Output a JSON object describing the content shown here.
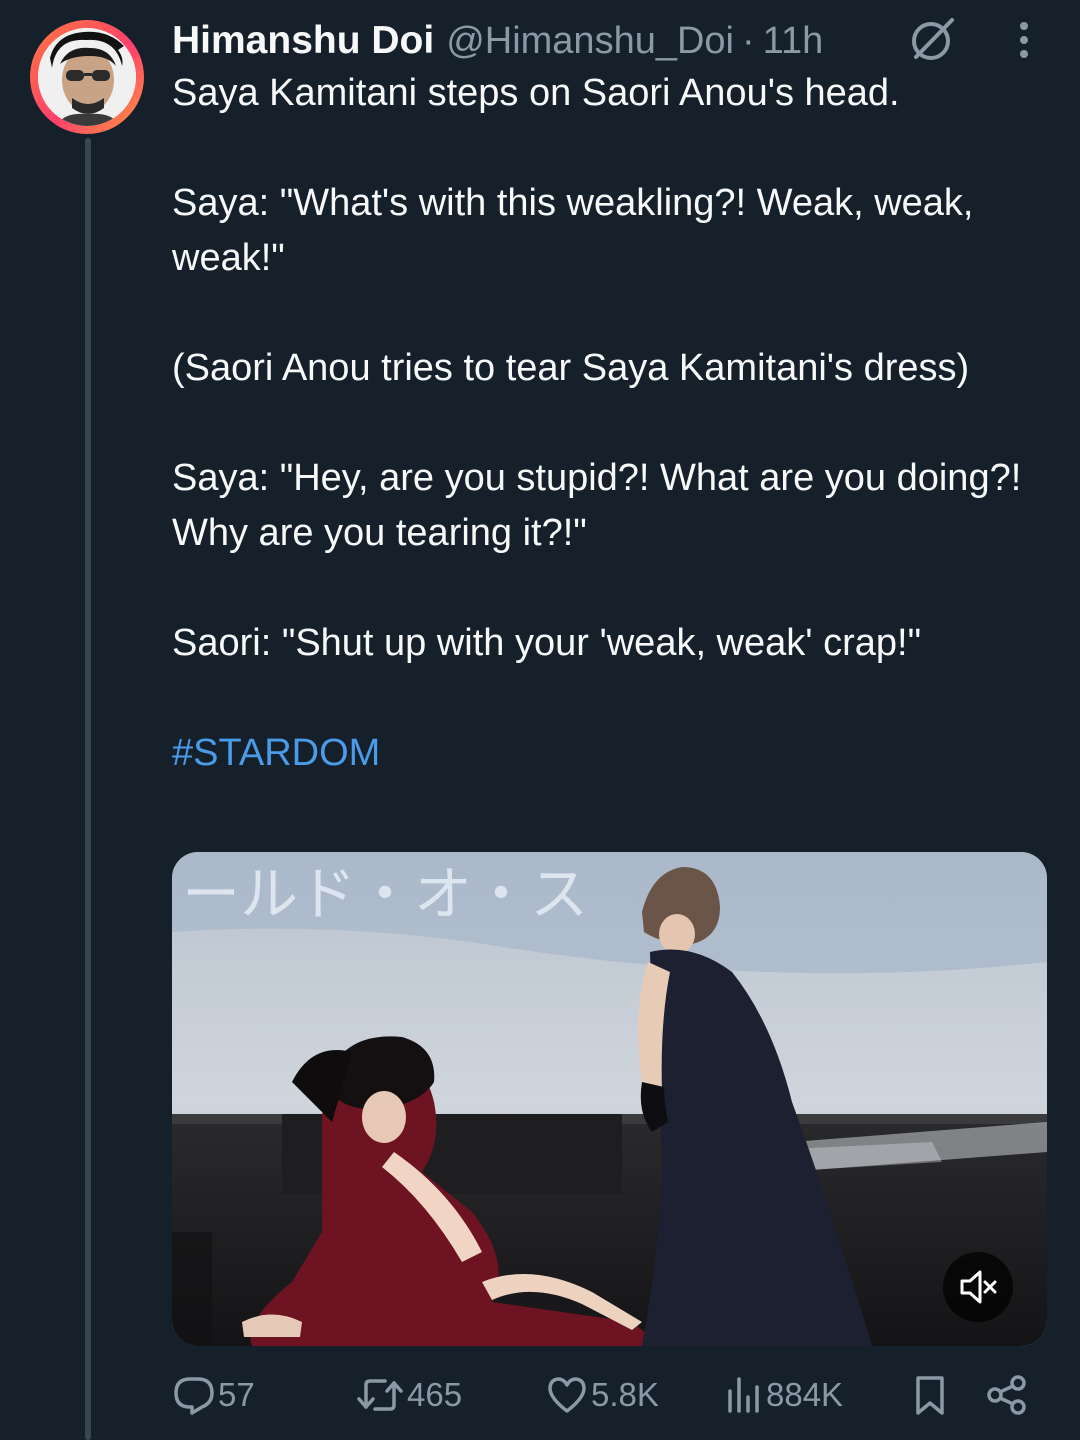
{
  "tweet": {
    "author": {
      "display_name": "Himanshu Doi",
      "handle": "@Himanshu_Doi",
      "separator": "·",
      "time": "11h"
    },
    "paragraphs": [
      "Saya Kamitani steps on Saori Anou's head.",
      "Saya: \"What's with this weakling?! Weak, weak, weak!\"",
      "(Saori Anou tries to tear Saya Kamitani's dress)",
      "Saya: \"Hey, are you stupid?! What are you doing?! Why are you tearing it?!\"",
      "Saori: \"Shut up with your 'weak, weak' crap!\""
    ],
    "hashtag": "#STARDOM",
    "media": {
      "kind": "video",
      "muted": true,
      "background_text": "ールド・オ・ス"
    },
    "stats": {
      "replies": "57",
      "reposts": "465",
      "likes": "5.8K",
      "views": "884K"
    }
  },
  "icons": {
    "grok": "grok-icon",
    "more": "more-icon",
    "reply": "reply-icon",
    "repost": "repost-icon",
    "like": "heart-icon",
    "views": "views-icon",
    "bookmark": "bookmark-icon",
    "share": "share-icon",
    "mute": "speaker-muted-icon"
  },
  "colors": {
    "background": "#15202b",
    "text": "#f7f9f9",
    "secondary_text": "#8b98a5",
    "link": "#4a9be8",
    "thread_line": "#3a4652"
  }
}
